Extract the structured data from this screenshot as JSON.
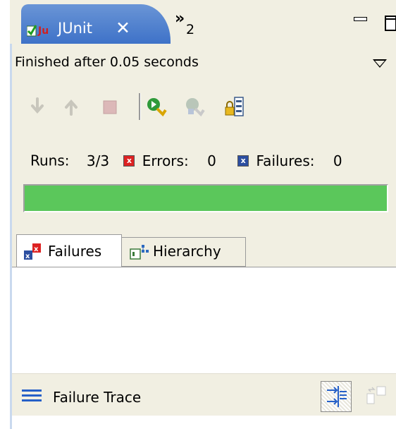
{
  "view": {
    "tab_title": "JUnit",
    "close_glyph": "✕",
    "overflow_chevron": "»",
    "overflow_count": "2",
    "minimize_icon": "minimize-icon",
    "maximize_icon": "maximize-icon"
  },
  "status": {
    "text": "Finished after 0.05 seconds"
  },
  "toolbar": {
    "buttons": [
      {
        "name": "next-failure-icon",
        "enabled": false
      },
      {
        "name": "previous-failure-icon",
        "enabled": false
      },
      {
        "name": "stop-icon",
        "enabled": false
      },
      {
        "name": "rerun-test-icon",
        "enabled": true
      },
      {
        "name": "rerun-failed-first-icon",
        "enabled": false
      },
      {
        "name": "scroll-lock-icon",
        "enabled": true
      }
    ]
  },
  "counters": {
    "runs_label": "Runs:",
    "runs_value": "3/3",
    "errors_label": "Errors:",
    "errors_value": "0",
    "failures_label": "Failures:",
    "failures_value": "0"
  },
  "progress": {
    "fraction": 1.0,
    "color": "#5bc75b"
  },
  "tabs": [
    {
      "label": "Failures",
      "selected": true,
      "icon": "failures-icon"
    },
    {
      "label": "Hierarchy",
      "selected": false,
      "icon": "hierarchy-icon"
    }
  ],
  "trace": {
    "title": "Failure Trace",
    "icon": "stack-trace-icon",
    "filter_icon": "filter-stack-trace-icon",
    "compare_icon": "compare-results-icon"
  },
  "colors": {
    "accent_tab": "#3e72c8",
    "view_bg": "#f1efe2",
    "error_red": "#d22222",
    "failure_blue": "#2c4ea0"
  }
}
